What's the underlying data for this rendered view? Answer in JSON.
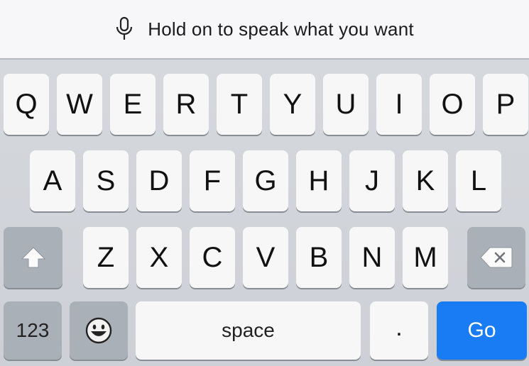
{
  "voice": {
    "text": "Hold on to speak what you want",
    "icon": "microphone-icon"
  },
  "rows": {
    "row1": [
      "Q",
      "W",
      "E",
      "R",
      "T",
      "Y",
      "U",
      "I",
      "O",
      "P"
    ],
    "row2": [
      "A",
      "S",
      "D",
      "F",
      "G",
      "H",
      "J",
      "K",
      "L"
    ],
    "row3": [
      "Z",
      "X",
      "C",
      "V",
      "B",
      "N",
      "M"
    ]
  },
  "bottom": {
    "numbers_label": "123",
    "emoji_icon": "emoji-icon",
    "space_label": "space",
    "period_label": ".",
    "go_label": "Go"
  },
  "icons": {
    "shift": "shift-icon",
    "delete": "delete-icon"
  },
  "colors": {
    "go_key": "#1a7cf5",
    "letter_key": "#f7f7f7",
    "modifier_key": "#aab0b8"
  }
}
